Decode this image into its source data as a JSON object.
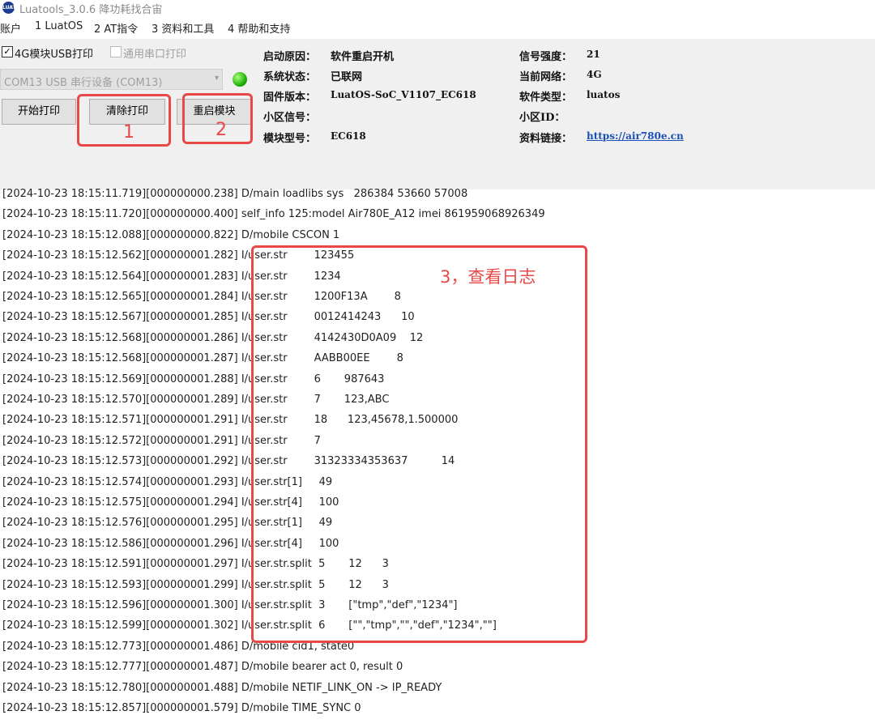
{
  "window": {
    "title": "Luatools_3.0.6 降功耗找合宙",
    "icon_text": "LUAT"
  },
  "menu": [
    "账户",
    "1 LuatOS",
    "2 AT指令",
    "3 资料和工具",
    "4 帮助和支持"
  ],
  "controls": {
    "usb_print_label": "4G模块USB打印",
    "usb_print_checked": true,
    "serial_print_label": "通用串口打印",
    "serial_print_checked": false,
    "port_value": "COM13 USB 串行设备 (COM13)",
    "status_color": "#23b20a",
    "start_print_label": "开始打印",
    "clear_print_label": "清除打印",
    "restart_module_label": "重启模块"
  },
  "info": {
    "boot_reason_label": "启动原因：",
    "boot_reason": "软件重启开机",
    "system_status_label": "系统状态：",
    "system_status": "已联网",
    "firmware_label": "固件版本：",
    "firmware": "LuatOS-SoC_V1107_EC618",
    "cell_signal_label": "小区信号：",
    "cell_signal": "",
    "module_model_label": "模块型号：",
    "module_model": "EC618",
    "signal_strength_label": "信号强度：",
    "signal_strength": "21",
    "network_label": "当前网络：",
    "network": "4G",
    "software_type_label": "软件类型：",
    "software_type": "luatos",
    "cell_id_label": "小区ID：",
    "cell_id": "",
    "resource_link_label": "资料链接：",
    "resource_link": "https://air780e.cn"
  },
  "log_lines": [
    "[2024-10-23 18:15:11.719][000000000.238] D/main loadlibs sys   286384 53660 57008",
    "[2024-10-23 18:15:11.720][000000000.400] self_info 125:model Air780E_A12 imei 861959068926349",
    "[2024-10-23 18:15:12.088][000000000.822] D/mobile CSCON 1",
    "[2024-10-23 18:15:12.562][000000001.282] I/user.str        123455",
    "[2024-10-23 18:15:12.564][000000001.283] I/user.str        1234",
    "[2024-10-23 18:15:12.565][000000001.284] I/user.str        1200F13A        8",
    "[2024-10-23 18:15:12.567][000000001.285] I/user.str        0012414243      10",
    "[2024-10-23 18:15:12.568][000000001.286] I/user.str        4142430D0A09    12",
    "[2024-10-23 18:15:12.568][000000001.287] I/user.str        AABB00EE        8",
    "[2024-10-23 18:15:12.569][000000001.288] I/user.str        6       987643",
    "[2024-10-23 18:15:12.570][000000001.289] I/user.str        7       123,ABC",
    "[2024-10-23 18:15:12.571][000000001.291] I/user.str        18      123,45678,1.500000",
    "[2024-10-23 18:15:12.572][000000001.291] I/user.str        7",
    "[2024-10-23 18:15:12.573][000000001.292] I/user.str        31323334353637          14",
    "[2024-10-23 18:15:12.574][000000001.293] I/user.str[1]     49",
    "[2024-10-23 18:15:12.575][000000001.294] I/user.str[4]     100",
    "[2024-10-23 18:15:12.576][000000001.295] I/user.str[1]     49",
    "[2024-10-23 18:15:12.586][000000001.296] I/user.str[4]     100",
    "[2024-10-23 18:15:12.591][000000001.297] I/user.str.split  5       12      3",
    "[2024-10-23 18:15:12.593][000000001.299] I/user.str.split  5       12      3",
    "[2024-10-23 18:15:12.596][000000001.300] I/user.str.split  3       [\"tmp\",\"def\",\"1234\"]",
    "[2024-10-23 18:15:12.599][000000001.302] I/user.str.split  6       [\"\",\"tmp\",\"\",\"def\",\"1234\",\"\"]",
    "[2024-10-23 18:15:12.773][000000001.486] D/mobile cid1, state0",
    "[2024-10-23 18:15:12.777][000000001.487] D/mobile bearer act 0, result 0",
    "[2024-10-23 18:15:12.780][000000001.488] D/mobile NETIF_LINK_ON -> IP_READY",
    "[2024-10-23 18:15:12.857][000000001.579] D/mobile TIME_SYNC 0"
  ],
  "annotations": {
    "one": "1",
    "two": "2",
    "three": "3，查看日志",
    "color": "#e84848"
  }
}
